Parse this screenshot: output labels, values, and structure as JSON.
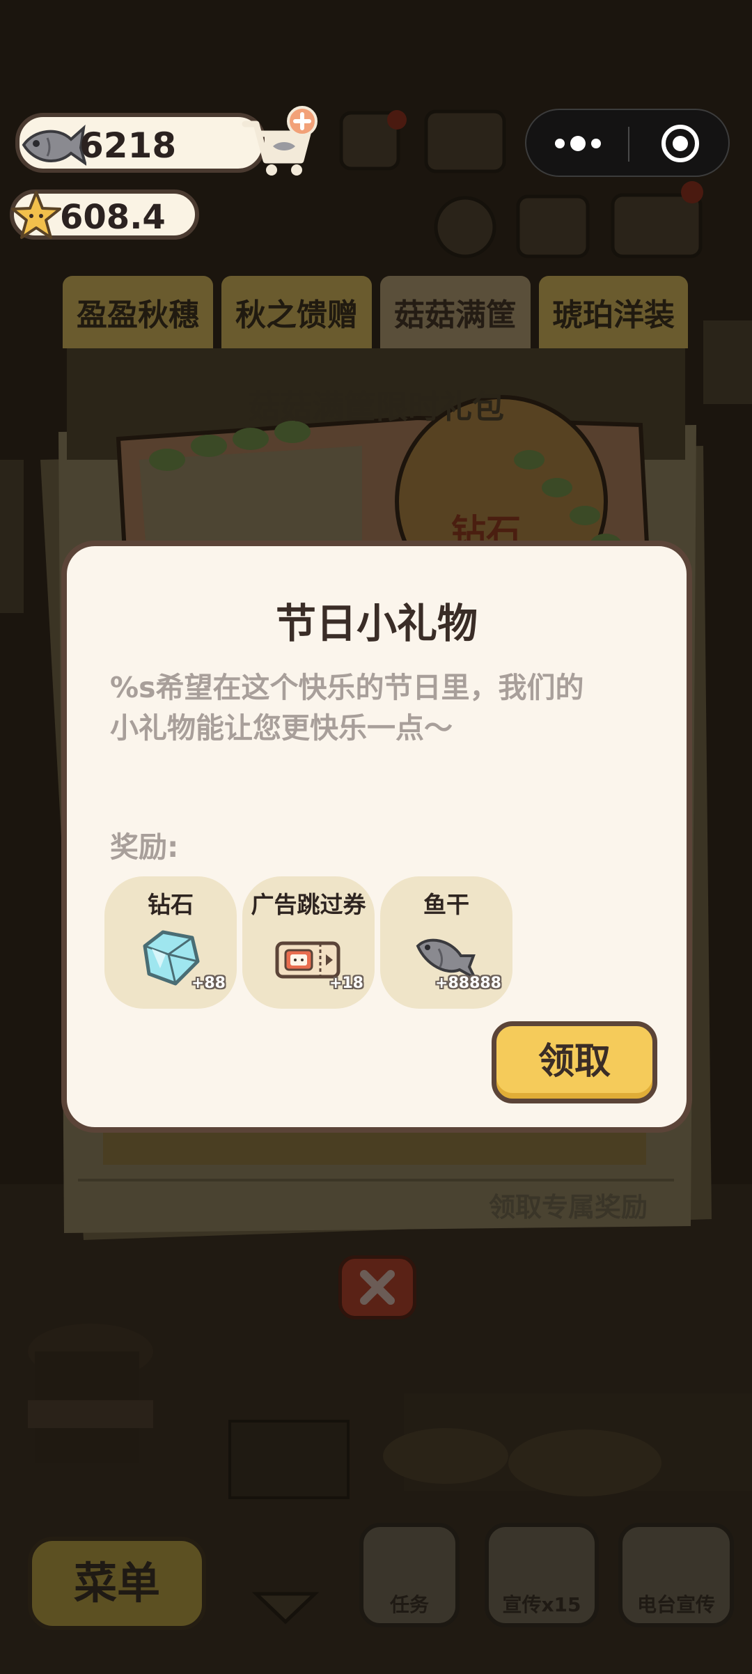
{
  "currency": {
    "fish": "6218",
    "stars": "608.4"
  },
  "event_tabs": [
    {
      "label": "盈盈秋穗"
    },
    {
      "label": "秋之馈赠"
    },
    {
      "label": "菇菇满筐"
    },
    {
      "label": "琥珀洋装"
    }
  ],
  "event_panel": {
    "title": "菇菇满筐限时礼包",
    "badge": "钻石",
    "claim_exclusive": "领取专属奖励"
  },
  "modal": {
    "title": "节日小礼物",
    "message_line1": "%s希望在这个快乐的节日里，我们的",
    "message_line2": "小礼物能让您更快乐一点～",
    "rewards_label": "奖励:",
    "rewards": [
      {
        "name": "钻石",
        "qty": "+88",
        "icon": "diamond-icon"
      },
      {
        "name": "广告跳过券",
        "qty": "+18",
        "icon": "ad-skip-ticket-icon"
      },
      {
        "name": "鱼干",
        "qty": "+88888",
        "icon": "dried-fish-icon"
      }
    ],
    "claim_button": "领取"
  },
  "bottom_bar": {
    "menu": "菜单",
    "task": "任务",
    "promote": "宣传x15",
    "radio": "电台宣传"
  },
  "colors": {
    "modal_bg": "#fbf5ec",
    "modal_border": "#5b4438",
    "claim_button": "#f5cb5a",
    "reward_tile": "#efe4c8",
    "muted_text": "#a89f9a"
  }
}
